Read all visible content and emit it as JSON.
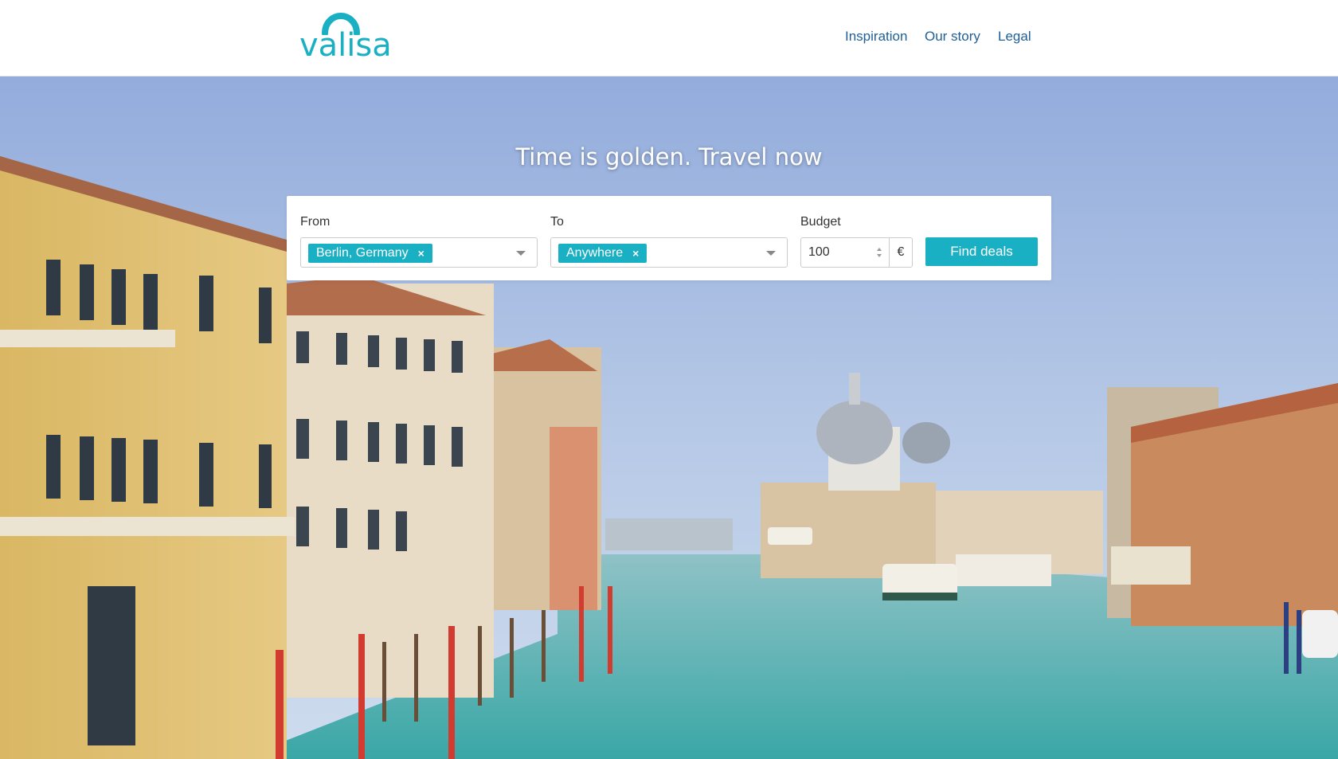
{
  "brand": {
    "name": "valisa",
    "color": "#1ab0c3"
  },
  "nav": {
    "items": [
      {
        "label": "Inspiration"
      },
      {
        "label": "Our story"
      },
      {
        "label": "Legal"
      }
    ],
    "color": "#1f5f95"
  },
  "hero": {
    "title": "Time is golden. Travel now"
  },
  "search": {
    "from": {
      "label": "From",
      "selected": "Berlin, Germany",
      "remove": "×"
    },
    "to": {
      "label": "To",
      "selected": "Anywhere",
      "remove": "×"
    },
    "budget": {
      "label": "Budget",
      "value": "100",
      "currency": "€"
    },
    "submit_label": "Find deals"
  },
  "icons": [
    "logo-arc-icon",
    "chevron-down-icon",
    "close-icon",
    "spinner-icon"
  ]
}
